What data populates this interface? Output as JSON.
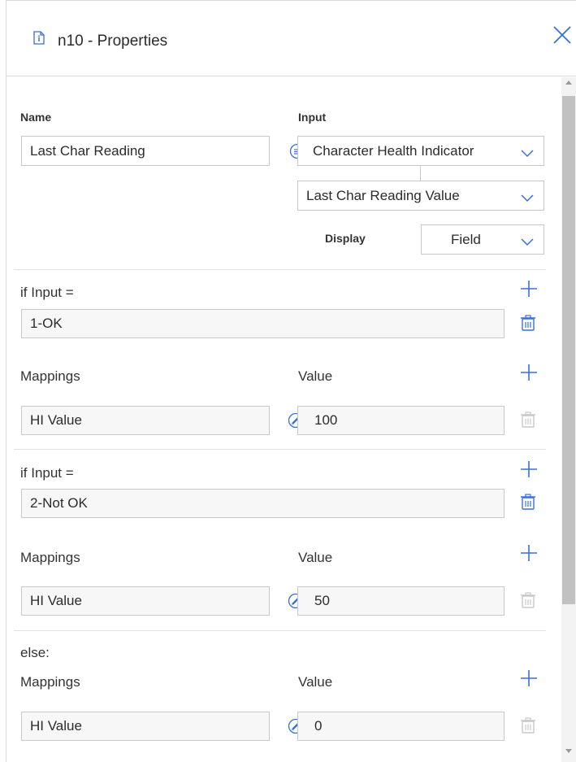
{
  "header": {
    "title": "n10 - Properties",
    "doc_icon": "document-icon",
    "close_icon": "close-icon"
  },
  "name_section": {
    "name_label": "Name",
    "name_value": "Last Char Reading",
    "input_label": "Input",
    "input_primary": "Character Health Indicator",
    "input_secondary": "Last Char Reading Value",
    "display_label": "Display",
    "display_value": "Field"
  },
  "conditions": [
    {
      "if_label": "if Input =",
      "if_value": "1-OK",
      "mappings_label": "Mappings",
      "value_label": "Value",
      "mapping_field": "HI Value",
      "mapping_value": "100"
    },
    {
      "if_label": "if Input =",
      "if_value": "2-Not OK",
      "mappings_label": "Mappings",
      "value_label": "Value",
      "mapping_field": "HI Value",
      "mapping_value": "50"
    }
  ],
  "else_block": {
    "else_label": "else:",
    "mappings_label": "Mappings",
    "value_label": "Value",
    "mapping_field": "HI Value",
    "mapping_value": "0"
  },
  "colors": {
    "accent": "#3a6fd8",
    "trash_active": "#3a6fd8",
    "trash_disabled": "#c8c8c8"
  }
}
